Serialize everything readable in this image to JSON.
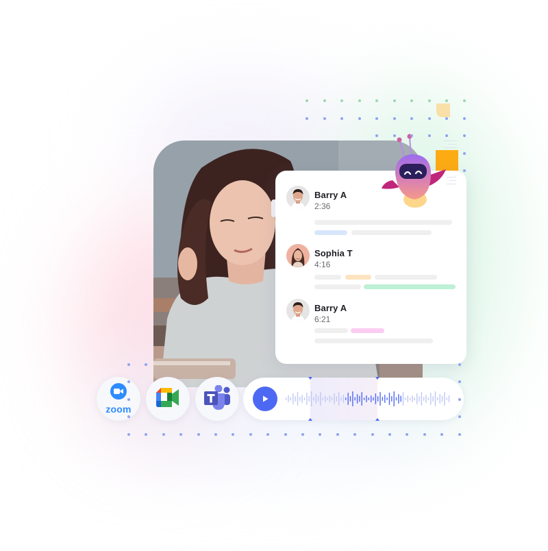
{
  "colors": {
    "accent_blue": "#4d69f4",
    "wave_inactive": "#bfc8f6",
    "dot_blue": "#8ea4f0",
    "dot_green": "#9ad8ae",
    "tag_blue": "#d8e6fb",
    "tag_orange": "#fde3bf",
    "tag_green": "#bdf0d4",
    "tag_pink": "#fbcdf2",
    "zoom_blue": "#2d8cff",
    "teams_purple": "#5059c9",
    "robot_orange": "#fdab12"
  },
  "transcript": {
    "entries": [
      {
        "speaker": "Barry A",
        "timestamp": "2:36",
        "avatar_icon": "man-avatar",
        "highlight_tag": "blue"
      },
      {
        "speaker": "Sophia T",
        "timestamp": "4:16",
        "avatar_icon": "woman-avatar",
        "highlight_tag": "orange-green"
      },
      {
        "speaker": "Barry A",
        "timestamp": "6:21",
        "avatar_icon": "man-avatar",
        "highlight_tag": "pink"
      }
    ]
  },
  "integrations": [
    {
      "name": "Zoom",
      "label": "zoom",
      "icon": "zoom-icon"
    },
    {
      "name": "Google Meet",
      "icon": "google-meet-icon"
    },
    {
      "name": "Microsoft Teams",
      "icon": "teams-icon"
    }
  ],
  "player": {
    "play_icon": "play-icon",
    "selection_start": 0.35,
    "selection_end": 0.7
  },
  "mascot": {
    "icon": "robot-mascot-icon"
  }
}
